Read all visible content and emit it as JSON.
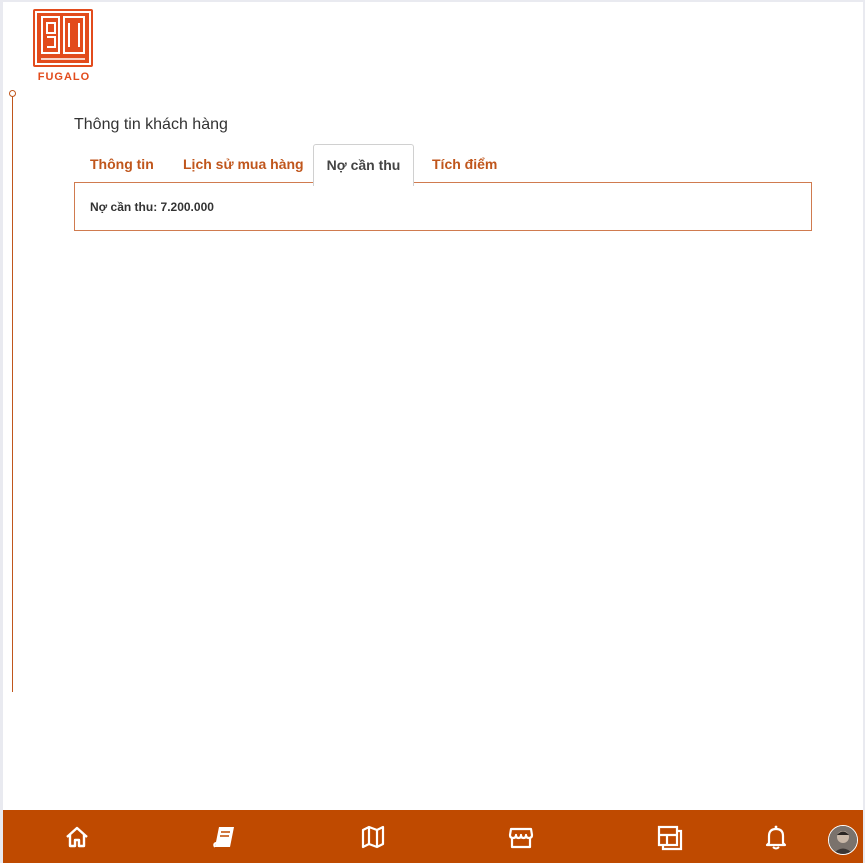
{
  "brand": {
    "name": "FUGALO",
    "logo_color": "#e24b1c"
  },
  "page": {
    "title": "Thông tin khách hàng"
  },
  "tabs": [
    {
      "label": "Thông tin",
      "active": false
    },
    {
      "label": "Lịch sử mua hàng",
      "active": false
    },
    {
      "label": "Nợ cần thu",
      "active": true
    },
    {
      "label": "Tích điểm",
      "active": false
    }
  ],
  "debt": {
    "text": "Nợ cần thu: 7.200.000"
  },
  "bottom_nav": {
    "background": "#bf4a00",
    "items": [
      {
        "icon": "home-icon"
      },
      {
        "icon": "book-icon"
      },
      {
        "icon": "map-icon"
      },
      {
        "icon": "store-icon"
      },
      {
        "icon": "layout-icon"
      },
      {
        "icon": "bell-icon"
      },
      {
        "icon": "avatar"
      }
    ]
  },
  "colors": {
    "accent": "#c0561c",
    "text": "#333333"
  }
}
